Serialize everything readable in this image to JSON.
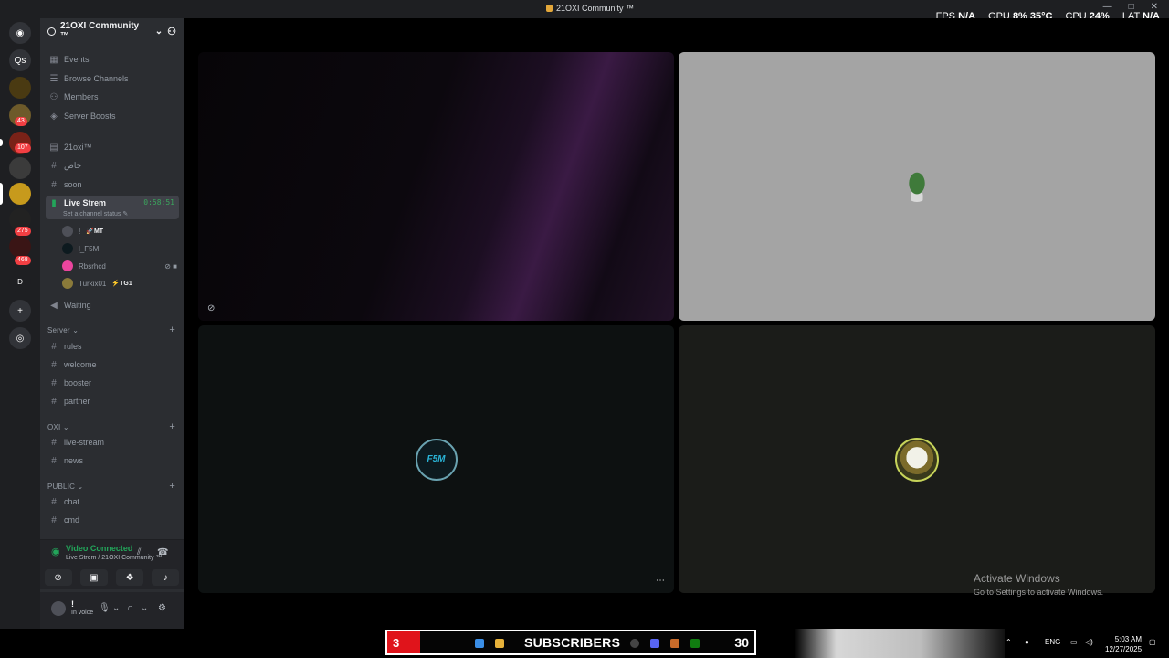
{
  "window": {
    "title": "21OXI Community ™"
  },
  "hud": {
    "fps_label": "FPS",
    "fps_value": "N/A",
    "gpu_label": "GPU",
    "gpu_value": "8%",
    "gpu_temp": "35°C",
    "cpu_label": "CPU",
    "cpu_value": "24%",
    "lat_label": "LAT",
    "lat_value": "N/A"
  },
  "rail": {
    "badges": [
      "43",
      "107",
      "275",
      "468"
    ],
    "letter_d": "D"
  },
  "server": {
    "name": "21OXI Community ™"
  },
  "nav": {
    "events": "Events",
    "browse": "Browse Channels",
    "members": "Members",
    "boosts": "Server Boosts"
  },
  "channels": {
    "c1": "21oxi™",
    "c2": "خاص",
    "c3": "soon",
    "live": "Live Strem",
    "live_status": "Set a channel status",
    "live_timer": "0:58:51",
    "waiting": "Waiting"
  },
  "voice_users": [
    {
      "name": "!",
      "tag": "🚀MT"
    },
    {
      "name": "l_F5M",
      "tag": ""
    },
    {
      "name": "Rbsrhcd",
      "tag": ""
    },
    {
      "name": "Turkix01",
      "tag": "⚡TG1"
    }
  ],
  "categories": {
    "server": "Server",
    "oxi": "OXI",
    "public": "PUBLIC"
  },
  "server_channels": [
    "rules",
    "welcome",
    "booster",
    "partner"
  ],
  "oxi_channels": [
    "live-stream",
    "news"
  ],
  "public_channels": [
    "chat",
    "cmd"
  ],
  "vc": {
    "status": "Video Connected",
    "location": "Live Strem / 21OXI Community ™"
  },
  "user": {
    "name": "!",
    "status": "In voice"
  },
  "stage": {
    "tile3_logo": "F5M"
  },
  "activate": {
    "line1": "Activate Windows",
    "line2": "Go to Settings to activate Windows."
  },
  "taskbar": {
    "sub_count_left": "3",
    "sub_text": "SUBSCRIBERS",
    "sub_count_right": "30",
    "lang": "ENG",
    "time": "5:03 AM",
    "date": "12/27/2025"
  },
  "colors": {
    "accent_green": "#23a55a",
    "live_red": "#e0141b"
  }
}
